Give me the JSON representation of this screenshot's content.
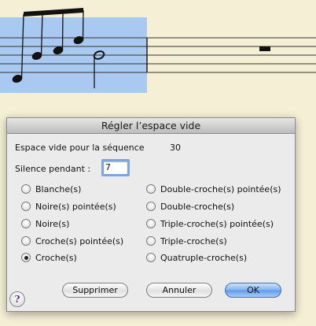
{
  "dialog": {
    "title": "Régler l’espace vide",
    "empty_space_label": "Espace vide pour la séquence",
    "empty_space_value": "30",
    "silence_label": "Silence pendant :",
    "silence_value": "7",
    "durations": [
      {
        "label": "Blanche(s)",
        "selected": false
      },
      {
        "label": "Noire(s) pointée(s)",
        "selected": false
      },
      {
        "label": "Noire(s)",
        "selected": false
      },
      {
        "label": "Croche(s) pointée(s)",
        "selected": false
      },
      {
        "label": "Croche(s)",
        "selected": true
      },
      {
        "label": "Double-croche(s) pointée(s)",
        "selected": false
      },
      {
        "label": "Double-croche(s)",
        "selected": false
      },
      {
        "label": "Triple-croche(s) pointée(s)",
        "selected": false
      },
      {
        "label": "Triple-croche(s)",
        "selected": false
      },
      {
        "label": "Quatruple-croche(s)",
        "selected": false
      }
    ],
    "buttons": {
      "delete": "Supprimer",
      "cancel": "Annuler",
      "ok": "OK"
    },
    "help": "?"
  },
  "colors": {
    "background": "#f5efd6",
    "selection_highlight": "#a9c9f0",
    "ok_button": "#6fa6ea",
    "field_focus": "#7aa6e0"
  }
}
